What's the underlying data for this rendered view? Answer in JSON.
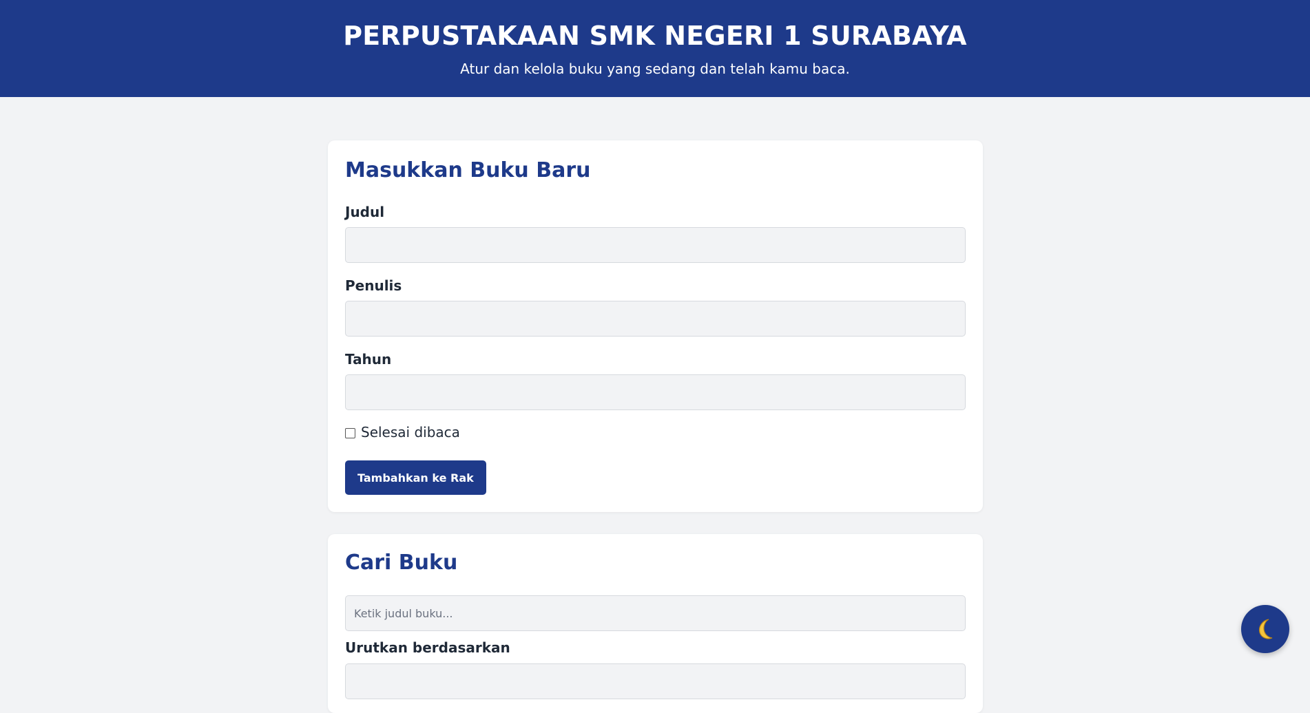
{
  "header": {
    "title": "PERPUSTAKAAN SMK NEGERI 1 SURABAYA",
    "subtitle": "Atur dan kelola buku yang sedang dan telah kamu baca."
  },
  "add_book_form": {
    "title": "Masukkan Buku Baru",
    "fields": [
      {
        "label": "Judul",
        "value": ""
      },
      {
        "label": "Penulis",
        "value": ""
      },
      {
        "label": "Tahun",
        "value": ""
      }
    ],
    "finished_checkbox": {
      "label": "Selesai dibaca",
      "checked": false
    },
    "submit_label": "Tambahkan ke Rak"
  },
  "search_section": {
    "title": "Cari Buku",
    "search_placeholder": "Ketik judul buku...",
    "sort_label": "Urutkan berdasarkan"
  },
  "theme_toggle": {
    "icon": "moon-icon"
  },
  "colors": {
    "brand": "#1e3a8a",
    "background": "#f2f3f5",
    "card": "#ffffff",
    "moon": "#f5c53c"
  }
}
